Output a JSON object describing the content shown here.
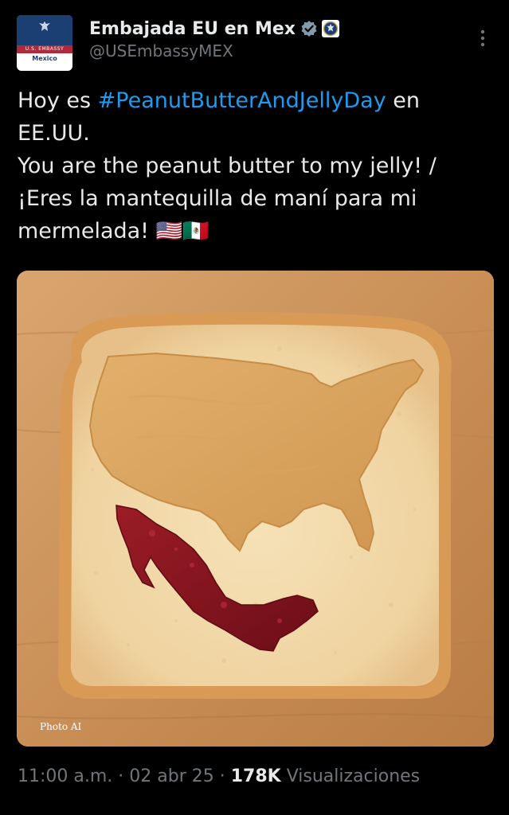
{
  "account": {
    "display_name": "Embajada EU en Mex",
    "handle": "@USEmbassyMEX",
    "verified_icon": "verified-badge-icon",
    "affiliation_icon": "seal-badge-icon",
    "avatar_line1": "U.S. EMBASSY",
    "avatar_line2": "Mexico"
  },
  "tweet": {
    "text_prefix": "Hoy es ",
    "hashtag": "#PeanutButterAndJellyDay",
    "text_after_hashtag": " en EE.UU.",
    "line_english": "You are the peanut butter to my jelly! /",
    "line_spanish": "¡Eres la mantequilla de maní para mi mermelada! ",
    "flags": "🇺🇸🇲🇽"
  },
  "media": {
    "credit": "Photo AI"
  },
  "meta": {
    "time": "11:00 a.m.",
    "sep1": " · ",
    "date": "02 abr 25",
    "sep2": " · ",
    "views_count": "178K",
    "views_label": " Visualizaciones"
  },
  "colors": {
    "background": "#000000",
    "text": "#e7e9ea",
    "muted": "#71767b",
    "hashtag": "#1d9bf0"
  }
}
